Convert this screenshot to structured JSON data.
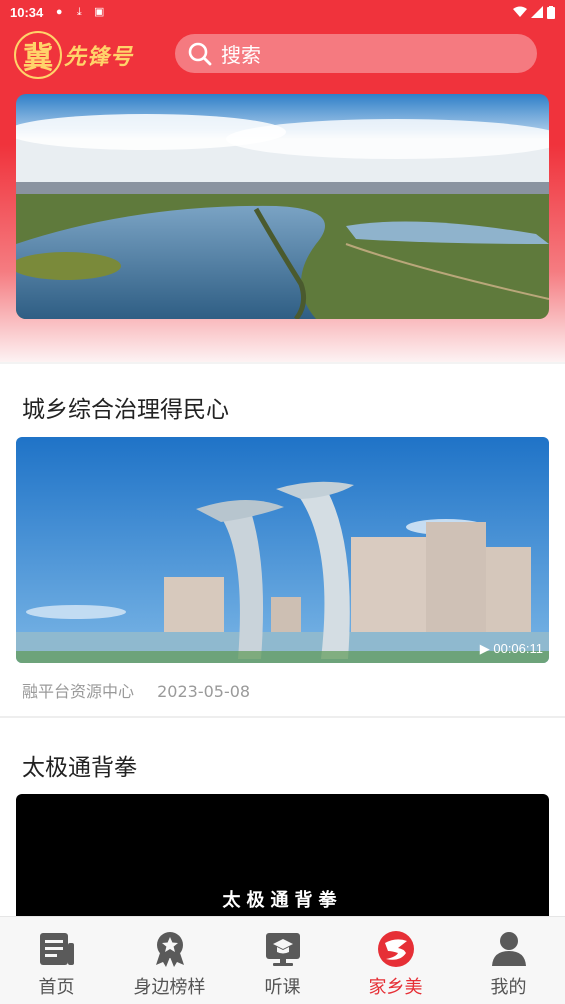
{
  "status_bar": {
    "time": "10:34"
  },
  "header": {
    "logo_char": "冀",
    "logo_text": "先锋号",
    "search_placeholder": "搜索"
  },
  "articles": [
    {
      "title": "城乡综合治理得民心",
      "duration": "00:06:11",
      "source": "融平台资源中心",
      "date": "2023-05-08"
    },
    {
      "title": "太极通背拳",
      "cover_text": "太极通背拳"
    }
  ],
  "tabs": [
    {
      "label": "首页",
      "icon": "news-icon"
    },
    {
      "label": "身边榜样",
      "icon": "medal-icon"
    },
    {
      "label": "听课",
      "icon": "lecture-icon"
    },
    {
      "label": "家乡美",
      "icon": "hometown-icon"
    },
    {
      "label": "我的",
      "icon": "user-icon"
    }
  ],
  "colors": {
    "brand_red": "#f0333c",
    "active_tab": "#e62f36",
    "logo_gold": "#ffd36a"
  }
}
